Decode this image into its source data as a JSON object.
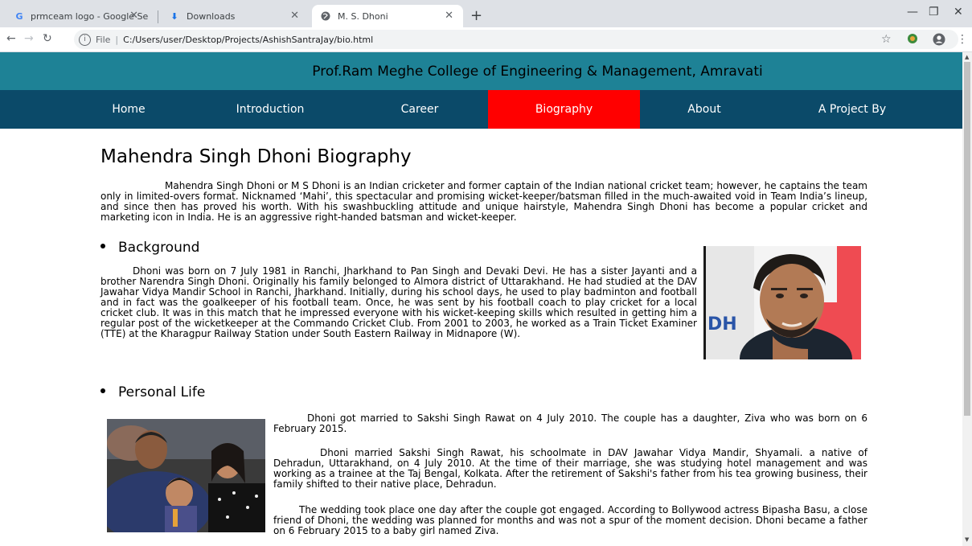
{
  "browser": {
    "tabs": [
      {
        "title": "prmceam logo - Google Search",
        "icon": "google-icon"
      },
      {
        "title": "Downloads",
        "icon": "download-icon"
      },
      {
        "title": "M. S. Dhoni",
        "icon": "globe-icon"
      }
    ],
    "address": {
      "scheme": "File",
      "path": "C:/Users/user/Desktop/Projects/AshishSantraJay/bio.html"
    }
  },
  "site": {
    "college_name": "Prof.Ram Meghe College of Engineering & Management, Amravati",
    "nav": [
      "Home",
      "Introduction",
      "Career",
      "Biography",
      "About",
      "A Project By"
    ],
    "active_nav": "Biography",
    "accent_color": "#ff0000",
    "header_color": "#1e8296",
    "nav_color": "#0b4a69"
  },
  "content": {
    "title": "Mahendra Singh Dhoni Biography",
    "intro": "Mahendra Singh Dhoni or M S Dhoni is an Indian cricketer and former captain of the Indian national cricket team; however, he captains the team only in limited-overs format. Nicknamed ‘Mahi’, this spectacular and promising wicket-keeper/batsman filled in the much-awaited void in Team India’s lineup, and since then has proved his worth. With his swashbuckling attitude and unique hairstyle, Mahendra Singh Dhoni has become a popular cricket and marketing icon in India. He is an aggressive right-handed batsman and wicket-keeper.",
    "background_heading": "Background",
    "background_text": "Dhoni was born on 7 July 1981 in Ranchi, Jharkhand to Pan Singh and Devaki Devi. He has a sister Jayanti and a brother Narendra Singh Dhoni. Originally his family belonged to Almora district of Uttarakhand. He had studied at the DAV Jawahar Vidya Mandir School in Ranchi, Jharkhand. Initially, during his school days, he used to play badminton and football and in fact was the goalkeeper of his football team. Once, he was sent by his football coach to play cricket for a local cricket club. It was in this match that he impressed everyone with his wicket-keeping skills which resulted in getting him a regular post of the wicketkeeper at the Commando Cricket Club. From 2001 to 2003, he worked as a Train Ticket Examiner (TTE) at the Kharagpur Railway Station under South Eastern Railway in Midnapore (W).",
    "photo1_text": "DH",
    "personal_heading": "Personal Life",
    "personal_1": "Dhoni got married to Sakshi Singh Rawat on 4 July 2010. The couple has a daughter, Ziva who was born on 6 February 2015.",
    "personal_2": "Dhoni married Sakshi Singh Rawat, his schoolmate in DAV Jawahar Vidya Mandir, Shyamali. a native of Dehradun, Uttarakhand, on 4 July 2010. At the time of their marriage, she was studying hotel management and was working as a trainee at the Taj Bengal, Kolkata. After the retirement of Sakshi's father from his tea growing business, their family shifted to their native place, Dehradun.",
    "personal_3": "The wedding took place one day after the couple got engaged. According to Bollywood actress Bipasha Basu, a close friend of Dhoni, the wedding was planned for months and was not a spur of the moment decision. Dhoni became a father on 6 February 2015 to a baby girl named Ziva."
  }
}
